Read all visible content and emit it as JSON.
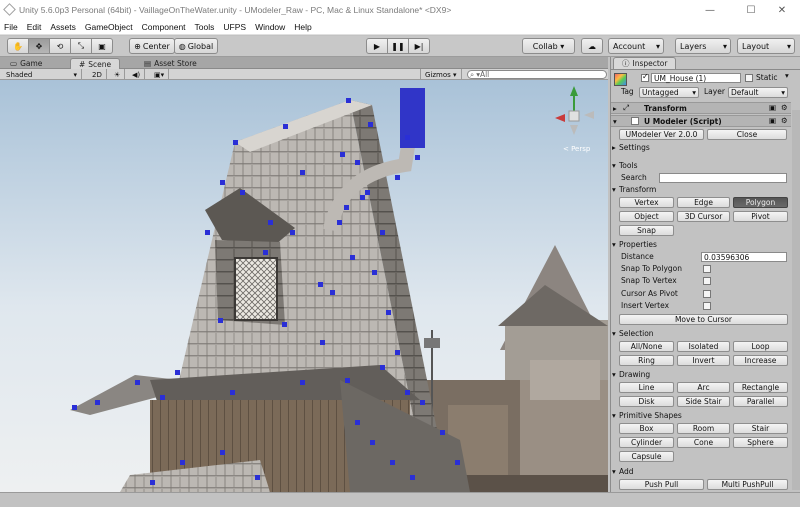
{
  "window": {
    "title": "Unity 5.6.0p3 Personal (64bit) - VaillageOnTheWater.unity - UModeler_Raw - PC, Mac & Linux Standalone* <DX9>",
    "minimize": "—",
    "maximize": "☐",
    "close": "✕"
  },
  "menu": [
    "File",
    "Edit",
    "Assets",
    "GameObject",
    "Component",
    "Tools",
    "UFPS",
    "Window",
    "Help"
  ],
  "toolbar": {
    "center": "Center",
    "global": "Global",
    "collab": "Collab ▾",
    "account": "Account",
    "layers": "Layers",
    "layout": "Layout"
  },
  "tabs": {
    "game": "Game",
    "scene": "Scene",
    "asset_store": "Asset Store"
  },
  "scene_toolbar": {
    "shaded": "Shaded",
    "mode2d": "2D",
    "gizmos": "Gizmos ▾",
    "search_placeholder": "▾All"
  },
  "gizmo": {
    "persp": "< Persp"
  },
  "inspector": {
    "tab": "Inspector",
    "object_name": "UM_House (1)",
    "static_label": "Static",
    "tag_label": "Tag",
    "tag_value": "Untagged",
    "layer_label": "Layer",
    "layer_value": "Default",
    "transform": "Transform",
    "umodeler": "U Modeler (Script)",
    "version_btn": "UModeler Ver 2.0.0",
    "close_btn": "Close",
    "settings": "Settings",
    "tools": "Tools",
    "search": "Search",
    "transform_section": "Transform",
    "vertex": "Vertex",
    "edge": "Edge",
    "polygon": "Polygon",
    "object": "Object",
    "cursor3d": "3D Cursor",
    "pivot": "Pivot",
    "snap": "Snap",
    "properties": "Properties",
    "distance_label": "Distance",
    "distance_value": "0.03596306",
    "snap_polygon": "Snap To Polygon",
    "snap_vertex": "Snap To Vertex",
    "cursor_pivot": "Cursor As Pivot",
    "insert_vertex": "Insert Vertex",
    "move_cursor": "Move to Cursor",
    "selection": "Selection",
    "allnone": "All/None",
    "isolated": "Isolated",
    "loop": "Loop",
    "ring": "Ring",
    "invert": "Invert",
    "increase": "Increase",
    "drawing": "Drawing",
    "line": "Line",
    "arc": "Arc",
    "rectangle": "Rectangle",
    "disk": "Disk",
    "sidestair": "Side Stair",
    "parallel": "Parallel",
    "primitive": "Primitive Shapes",
    "box": "Box",
    "room": "Room",
    "stair": "Stair",
    "cylinder": "Cylinder",
    "cone": "Cone",
    "sphere": "Sphere",
    "capsule": "Capsule",
    "add": "Add",
    "pushpull": "Push Pull",
    "multipushpull": "Multi PushPull"
  }
}
